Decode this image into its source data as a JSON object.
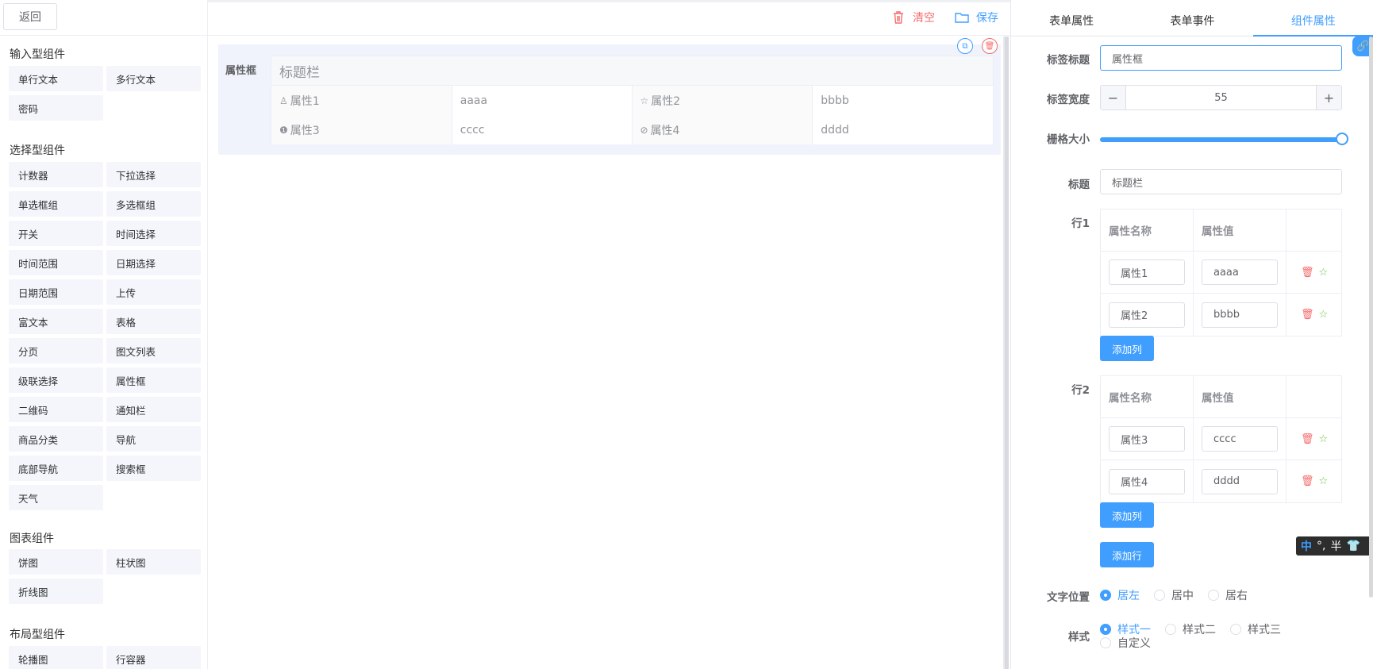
{
  "toolbar": {
    "back_label": "返回",
    "clear_label": "清空",
    "save_label": "保存"
  },
  "sidebar": {
    "groups": [
      {
        "title": "输入型组件",
        "items": [
          "单行文本",
          "多行文本",
          "密码"
        ]
      },
      {
        "title": "选择型组件",
        "items": [
          "计数器",
          "下拉选择",
          "单选框组",
          "多选框组",
          "开关",
          "时间选择",
          "时间范围",
          "日期选择",
          "日期范围",
          "上传",
          "富文本",
          "表格",
          "分页",
          "图文列表",
          "级联选择",
          "属性框",
          "二维码",
          "通知栏",
          "商品分类",
          "导航",
          "底部导航",
          "搜索框",
          "天气"
        ]
      },
      {
        "title": "图表组件",
        "items": [
          "饼图",
          "柱状图",
          "折线图"
        ]
      },
      {
        "title": "布局型组件",
        "items": [
          "轮播图",
          "行容器"
        ]
      }
    ]
  },
  "canvas": {
    "label": "属性框",
    "title": "标题栏",
    "rows": [
      [
        {
          "icon": "user-icon",
          "name": "属性1",
          "value": "aaaa"
        },
        {
          "icon": "star-icon",
          "name": "属性2",
          "value": "bbbb"
        }
      ],
      [
        {
          "icon": "info-icon",
          "name": "属性3",
          "value": "cccc"
        },
        {
          "icon": "check-circle-icon",
          "name": "属性4",
          "value": "dddd"
        }
      ]
    ]
  },
  "right_panel": {
    "tabs": [
      "表单属性",
      "表单事件",
      "组件属性"
    ],
    "active_tab": "组件属性",
    "label_title": {
      "label": "标签标题",
      "value": "属性框"
    },
    "label_width": {
      "label": "标签宽度",
      "value": "55",
      "minus": "−",
      "plus": "+"
    },
    "grid_size": {
      "label": "栅格大小",
      "value": 24,
      "max": 24
    },
    "title": {
      "label": "标题",
      "value": "标题栏"
    },
    "row1": {
      "label": "行1",
      "headers": [
        "属性名称",
        "属性值"
      ],
      "items": [
        {
          "name": "属性1",
          "value": "aaaa"
        },
        {
          "name": "属性2",
          "value": "bbbb"
        }
      ],
      "add_column": "添加列"
    },
    "row2": {
      "label": "行2",
      "headers": [
        "属性名称",
        "属性值"
      ],
      "items": [
        {
          "name": "属性3",
          "value": "cccc"
        },
        {
          "name": "属性4",
          "value": "dddd"
        }
      ],
      "add_column": "添加列"
    },
    "add_row": "添加行",
    "text_position": {
      "label": "文字位置",
      "options": [
        "居左",
        "居中",
        "居右"
      ],
      "selected": "居左"
    },
    "style": {
      "label": "样式",
      "options": [
        "样式一",
        "样式二",
        "样式三",
        "自定义"
      ],
      "selected": "样式一"
    }
  },
  "ime": {
    "mode": "中",
    "punct": "°,",
    "width": "半"
  },
  "colors": {
    "primary": "#409eff",
    "danger": "#f56c6c",
    "success": "#67c23a"
  }
}
